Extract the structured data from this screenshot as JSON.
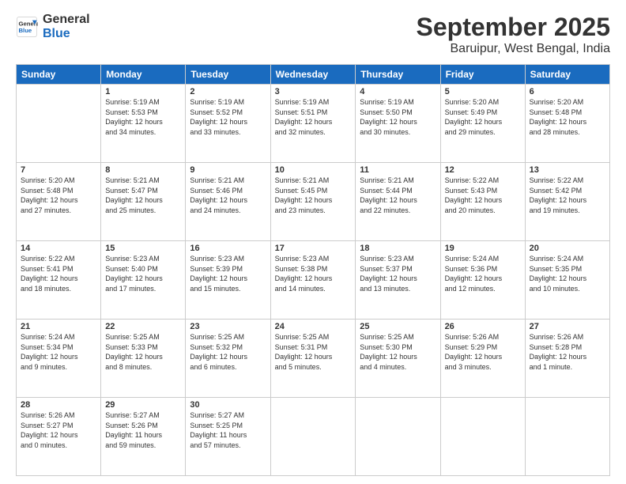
{
  "logo": {
    "general": "General",
    "blue": "Blue"
  },
  "header": {
    "title": "September 2025",
    "location": "Baruipur, West Bengal, India"
  },
  "weekdays": [
    "Sunday",
    "Monday",
    "Tuesday",
    "Wednesday",
    "Thursday",
    "Friday",
    "Saturday"
  ],
  "weeks": [
    [
      {
        "day": "",
        "info": ""
      },
      {
        "day": "1",
        "info": "Sunrise: 5:19 AM\nSunset: 5:53 PM\nDaylight: 12 hours\nand 34 minutes."
      },
      {
        "day": "2",
        "info": "Sunrise: 5:19 AM\nSunset: 5:52 PM\nDaylight: 12 hours\nand 33 minutes."
      },
      {
        "day": "3",
        "info": "Sunrise: 5:19 AM\nSunset: 5:51 PM\nDaylight: 12 hours\nand 32 minutes."
      },
      {
        "day": "4",
        "info": "Sunrise: 5:19 AM\nSunset: 5:50 PM\nDaylight: 12 hours\nand 30 minutes."
      },
      {
        "day": "5",
        "info": "Sunrise: 5:20 AM\nSunset: 5:49 PM\nDaylight: 12 hours\nand 29 minutes."
      },
      {
        "day": "6",
        "info": "Sunrise: 5:20 AM\nSunset: 5:48 PM\nDaylight: 12 hours\nand 28 minutes."
      }
    ],
    [
      {
        "day": "7",
        "info": "Sunrise: 5:20 AM\nSunset: 5:48 PM\nDaylight: 12 hours\nand 27 minutes."
      },
      {
        "day": "8",
        "info": "Sunrise: 5:21 AM\nSunset: 5:47 PM\nDaylight: 12 hours\nand 25 minutes."
      },
      {
        "day": "9",
        "info": "Sunrise: 5:21 AM\nSunset: 5:46 PM\nDaylight: 12 hours\nand 24 minutes."
      },
      {
        "day": "10",
        "info": "Sunrise: 5:21 AM\nSunset: 5:45 PM\nDaylight: 12 hours\nand 23 minutes."
      },
      {
        "day": "11",
        "info": "Sunrise: 5:21 AM\nSunset: 5:44 PM\nDaylight: 12 hours\nand 22 minutes."
      },
      {
        "day": "12",
        "info": "Sunrise: 5:22 AM\nSunset: 5:43 PM\nDaylight: 12 hours\nand 20 minutes."
      },
      {
        "day": "13",
        "info": "Sunrise: 5:22 AM\nSunset: 5:42 PM\nDaylight: 12 hours\nand 19 minutes."
      }
    ],
    [
      {
        "day": "14",
        "info": "Sunrise: 5:22 AM\nSunset: 5:41 PM\nDaylight: 12 hours\nand 18 minutes."
      },
      {
        "day": "15",
        "info": "Sunrise: 5:23 AM\nSunset: 5:40 PM\nDaylight: 12 hours\nand 17 minutes."
      },
      {
        "day": "16",
        "info": "Sunrise: 5:23 AM\nSunset: 5:39 PM\nDaylight: 12 hours\nand 15 minutes."
      },
      {
        "day": "17",
        "info": "Sunrise: 5:23 AM\nSunset: 5:38 PM\nDaylight: 12 hours\nand 14 minutes."
      },
      {
        "day": "18",
        "info": "Sunrise: 5:23 AM\nSunset: 5:37 PM\nDaylight: 12 hours\nand 13 minutes."
      },
      {
        "day": "19",
        "info": "Sunrise: 5:24 AM\nSunset: 5:36 PM\nDaylight: 12 hours\nand 12 minutes."
      },
      {
        "day": "20",
        "info": "Sunrise: 5:24 AM\nSunset: 5:35 PM\nDaylight: 12 hours\nand 10 minutes."
      }
    ],
    [
      {
        "day": "21",
        "info": "Sunrise: 5:24 AM\nSunset: 5:34 PM\nDaylight: 12 hours\nand 9 minutes."
      },
      {
        "day": "22",
        "info": "Sunrise: 5:25 AM\nSunset: 5:33 PM\nDaylight: 12 hours\nand 8 minutes."
      },
      {
        "day": "23",
        "info": "Sunrise: 5:25 AM\nSunset: 5:32 PM\nDaylight: 12 hours\nand 6 minutes."
      },
      {
        "day": "24",
        "info": "Sunrise: 5:25 AM\nSunset: 5:31 PM\nDaylight: 12 hours\nand 5 minutes."
      },
      {
        "day": "25",
        "info": "Sunrise: 5:25 AM\nSunset: 5:30 PM\nDaylight: 12 hours\nand 4 minutes."
      },
      {
        "day": "26",
        "info": "Sunrise: 5:26 AM\nSunset: 5:29 PM\nDaylight: 12 hours\nand 3 minutes."
      },
      {
        "day": "27",
        "info": "Sunrise: 5:26 AM\nSunset: 5:28 PM\nDaylight: 12 hours\nand 1 minute."
      }
    ],
    [
      {
        "day": "28",
        "info": "Sunrise: 5:26 AM\nSunset: 5:27 PM\nDaylight: 12 hours\nand 0 minutes."
      },
      {
        "day": "29",
        "info": "Sunrise: 5:27 AM\nSunset: 5:26 PM\nDaylight: 11 hours\nand 59 minutes."
      },
      {
        "day": "30",
        "info": "Sunrise: 5:27 AM\nSunset: 5:25 PM\nDaylight: 11 hours\nand 57 minutes."
      },
      {
        "day": "",
        "info": ""
      },
      {
        "day": "",
        "info": ""
      },
      {
        "day": "",
        "info": ""
      },
      {
        "day": "",
        "info": ""
      }
    ]
  ]
}
